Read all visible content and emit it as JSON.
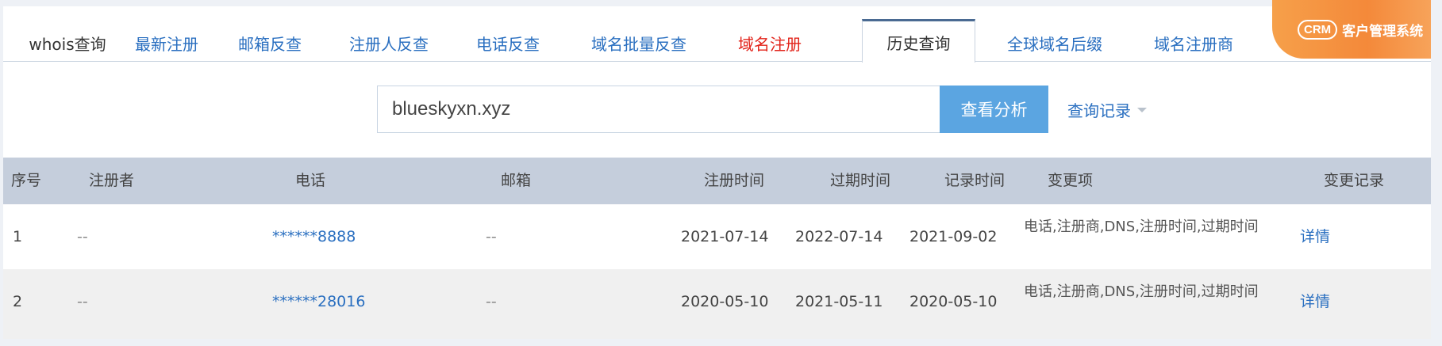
{
  "tabs": [
    {
      "label": "whois查询",
      "style": "plain"
    },
    {
      "label": "最新注册",
      "style": "link"
    },
    {
      "label": "邮箱反查",
      "style": "link"
    },
    {
      "label": "注册人反查",
      "style": "link"
    },
    {
      "label": "电话反查",
      "style": "link"
    },
    {
      "label": "域名批量反查",
      "style": "link"
    },
    {
      "label": "域名注册",
      "style": "red"
    },
    {
      "label": "历史查询",
      "style": "active"
    },
    {
      "label": "全球域名后缀",
      "style": "link"
    },
    {
      "label": "域名注册商",
      "style": "link"
    }
  ],
  "crm": {
    "badge": "CRM",
    "text": "客户管理系统"
  },
  "search": {
    "value": "blueskyxn.xyz",
    "button_label": "查看分析",
    "history_label": "查询记录"
  },
  "table": {
    "headers": [
      "序号",
      "注册者",
      "电话",
      "邮箱",
      "注册时间",
      "过期时间",
      "记录时间",
      "变更项",
      "变更记录"
    ],
    "rows": [
      {
        "index": "1",
        "registrant": "--",
        "phone": "******8888",
        "email": "--",
        "reg_date": "2021-07-14",
        "exp_date": "2022-07-14",
        "record_date": "2021-09-02",
        "changes": "电话,注册商,DNS,注册时间,过期时间",
        "detail": "详情"
      },
      {
        "index": "2",
        "registrant": "--",
        "phone": "******28016",
        "email": "--",
        "reg_date": "2020-05-10",
        "exp_date": "2021-05-11",
        "record_date": "2020-05-10",
        "changes": "电话,注册商,DNS,注册时间,过期时间",
        "detail": "详情"
      }
    ]
  },
  "colors": {
    "accent": "#5ba5e1",
    "link": "#2a6fc0",
    "red": "#e2231a",
    "header_bg": "#c5cedc",
    "crm": "#f4893a"
  }
}
